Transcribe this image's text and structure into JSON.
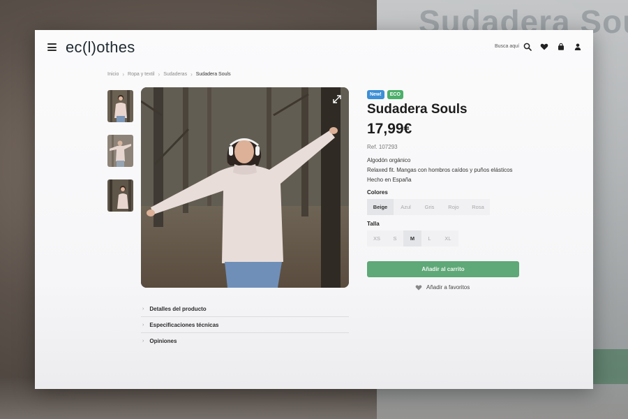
{
  "header": {
    "logo": "ec(l)othes",
    "search_label": "Busca aquí",
    "icons": [
      "menu-icon",
      "search-icon",
      "heart-icon",
      "bag-icon",
      "user-icon"
    ]
  },
  "breadcrumb": [
    "Inicio",
    "Ropa y textil",
    "Sudaderas",
    "Sudadera Souls"
  ],
  "product": {
    "badges": [
      {
        "label": "New!",
        "color": "#3d8fd6"
      },
      {
        "label": "ECO",
        "color": "#4caf6a"
      }
    ],
    "title": "Sudadera Souls",
    "price": "17,99€",
    "ref": "Ref. 107293",
    "description": [
      "Algodón orgánico",
      "Relaxed fit. Mangas con hombros caídos y puños elásticos",
      "Hecho en España"
    ],
    "colors_label": "Colores",
    "colors": [
      "Beige",
      "Azul",
      "Gris",
      "Rojo",
      "Rosa"
    ],
    "selected_color": "Beige",
    "size_label": "Talla",
    "sizes": [
      "XS",
      "S",
      "M",
      "L",
      "XL"
    ],
    "selected_size": "M",
    "add_to_cart": "Añadir al carrito",
    "add_to_favorites": "Añadir a favoritos"
  },
  "accordion": [
    "Detalles del producto",
    "Especificaciones técnicas",
    "Opiniones"
  ],
  "colors": {
    "accent_green": "#5fa877",
    "text_dark": "#1c1c1c"
  }
}
